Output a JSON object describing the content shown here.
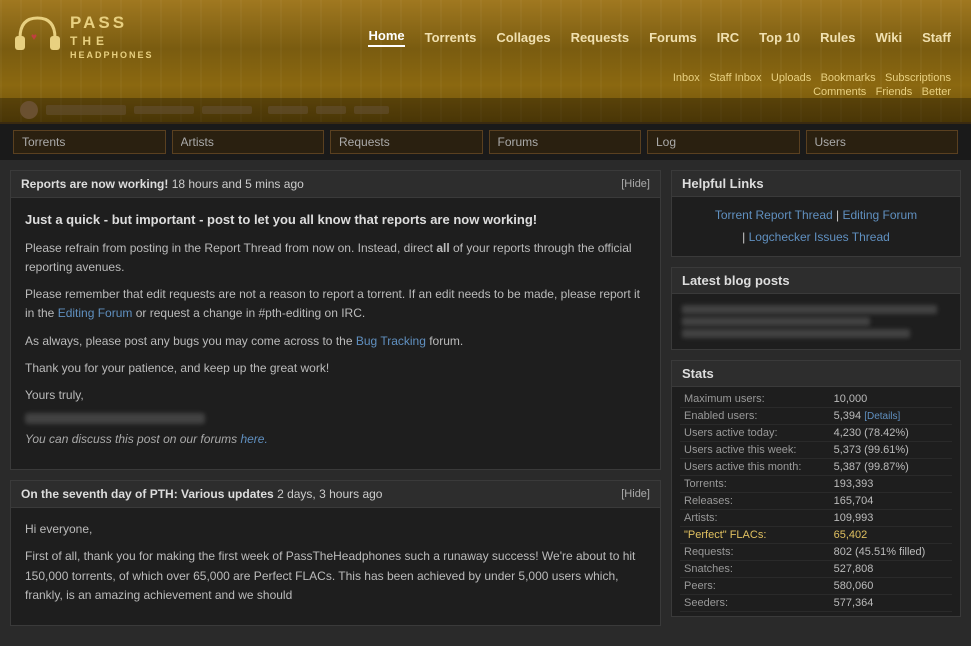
{
  "header": {
    "logo_line1": "PASS",
    "logo_line2": "THE",
    "logo_line3": "HEADPHONES",
    "nav": [
      {
        "label": "Home",
        "active": true
      },
      {
        "label": "Torrents",
        "active": false
      },
      {
        "label": "Collages",
        "active": false
      },
      {
        "label": "Requests",
        "active": false
      },
      {
        "label": "Forums",
        "active": false
      },
      {
        "label": "IRC",
        "active": false
      },
      {
        "label": "Top 10",
        "active": false
      },
      {
        "label": "Rules",
        "active": false
      },
      {
        "label": "Wiki",
        "active": false
      },
      {
        "label": "Staff",
        "active": false
      }
    ],
    "user_links": [
      "Inbox",
      "Staff Inbox",
      "Uploads",
      "Bookmarks",
      "Subscriptions",
      "Comments",
      "Friends",
      "Better"
    ]
  },
  "search_bars": [
    {
      "placeholder": "Torrents"
    },
    {
      "placeholder": "Artists"
    },
    {
      "placeholder": "Requests"
    },
    {
      "placeholder": "Forums"
    },
    {
      "placeholder": "Log"
    },
    {
      "placeholder": "Users"
    }
  ],
  "news_posts": [
    {
      "title": "Reports are now working!",
      "timestamp": "18 hours and 5 mins ago",
      "hide_label": "[Hide]",
      "intro": "Just a quick - but important - post to let you all know that reports are now working!",
      "paragraphs": [
        "Please refrain from posting in the Report Thread from now on. Instead, direct all of your reports through the official reporting avenues.",
        "Please remember that edit requests are not a reason to report a torrent. If an edit needs to be made, please report it in the Editing Forum or request a change in #pth-editing on IRC.",
        "As always, please post any bugs you may come across to the Bug Tracking forum.",
        "Thank you for your patience, and keep up the great work!",
        "Yours truly,"
      ],
      "editing_forum_link": "Editing Forum",
      "bug_tracking_link": "Bug Tracking",
      "forum_link": "here.",
      "forum_text": "You can discuss this post on our forums "
    },
    {
      "title": "On the seventh day of PTH: Various updates",
      "timestamp": "2 days, 3 hours ago",
      "hide_label": "[Hide]",
      "body_start": "Hi everyone,",
      "body_para": "First of all, thank you for making the first week of PassTheHeadphones such a runaway success! We're about to hit 150,000 torrents, of which over 65,000 are Perfect FLACs. This has been achieved by under 5,000 users which, frankly, is an amazing achievement and we should"
    }
  ],
  "sidebar": {
    "helpful_links_title": "Helpful Links",
    "helpful_links": [
      {
        "label": "Torrent Report Thread",
        "separator": " | "
      },
      {
        "label": "Editing Forum",
        "separator": ""
      },
      {
        "label": "| Logchecker Issues Thread",
        "separator": ""
      }
    ],
    "blog_title": "Latest blog posts",
    "stats_title": "Stats",
    "stats": [
      {
        "label": "Maximum users:",
        "value": "10,000"
      },
      {
        "label": "Enabled users:",
        "value": "5,394",
        "extra": "[Details]"
      },
      {
        "label": "Users active today:",
        "value": "4,230 (78.42%)"
      },
      {
        "label": "Users active this week:",
        "value": "5,373 (99.61%)"
      },
      {
        "label": "Users active this month:",
        "value": "5,387 (99.87%)"
      },
      {
        "label": "Torrents:",
        "value": "193,393"
      },
      {
        "label": "Releases:",
        "value": "165,704"
      },
      {
        "label": "Artists:",
        "value": "109,993"
      },
      {
        "label": "\"Perfect\" FLACs:",
        "value": "65,402",
        "highlight": true
      },
      {
        "label": "Requests:",
        "value": "802 (45.51% filled)"
      },
      {
        "label": "Snatches:",
        "value": "527,808"
      },
      {
        "label": "Peers:",
        "value": "580,060"
      },
      {
        "label": "Seeders:",
        "value": "577,364"
      }
    ]
  }
}
